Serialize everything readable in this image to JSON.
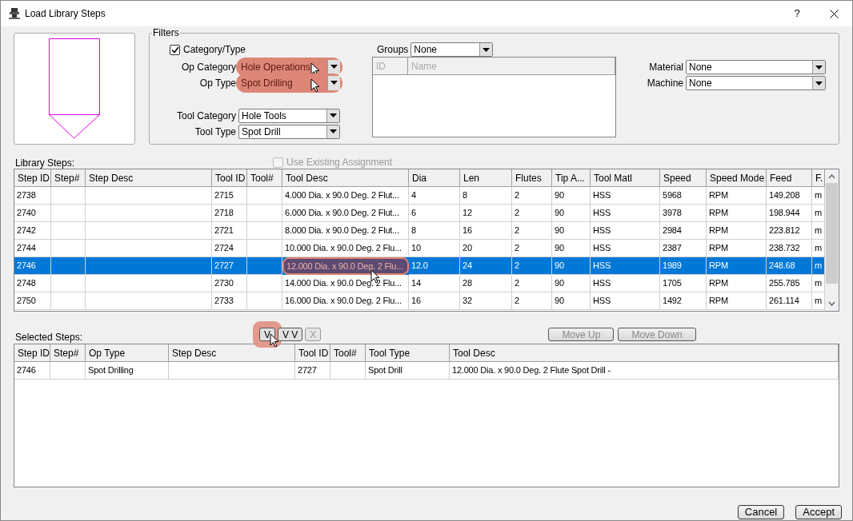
{
  "window": {
    "title": "Load Library Steps",
    "help": "?"
  },
  "filters": {
    "title": "Filters",
    "category_type": {
      "label": "Category/Type",
      "checked": true
    },
    "left_fields": [
      {
        "label": "Op Category",
        "value": "Hole Operations",
        "highlighted": true
      },
      {
        "label": "Op Type",
        "value": "Spot Drilling",
        "highlighted": true
      },
      {
        "label": "Tool Category",
        "value": "Hole Tools",
        "highlighted": false
      },
      {
        "label": "Tool Type",
        "value": "Spot Drill",
        "highlighted": false
      }
    ],
    "groups": {
      "label": "Groups",
      "value": "None",
      "columns": [
        "ID",
        "Name"
      ]
    },
    "right_fields": [
      {
        "label": "Material",
        "value": "None"
      },
      {
        "label": "Machine",
        "value": "None"
      }
    ]
  },
  "library_steps": {
    "label": "Library Steps:",
    "use_existing": {
      "label": "Use Existing Assignment",
      "checked": false,
      "disabled": true
    },
    "columns": [
      "Step ID",
      "Step#",
      "Step Desc",
      "Tool ID",
      "Tool#",
      "Tool Desc",
      "Dia",
      "Len",
      "Flutes",
      "Tip A...",
      "Tool Matl",
      "Speed",
      "Speed Mode",
      "Feed",
      "F."
    ],
    "rows": [
      {
        "selected": false,
        "cells": [
          "2738",
          "",
          "",
          "2715",
          "",
          "4.000 Dia. x 90.0 Deg. 2 Flut...",
          "4",
          "8",
          "2",
          "90",
          "HSS",
          "5968",
          "RPM",
          "149.208",
          "m"
        ]
      },
      {
        "selected": false,
        "cells": [
          "2740",
          "",
          "",
          "2718",
          "",
          "6.000 Dia. x 90.0 Deg. 2 Flut...",
          "6",
          "12",
          "2",
          "90",
          "HSS",
          "3978",
          "RPM",
          "198.944",
          "m"
        ]
      },
      {
        "selected": false,
        "cells": [
          "2742",
          "",
          "",
          "2721",
          "",
          "8.000 Dia. x 90.0 Deg. 2 Flut...",
          "8",
          "16",
          "2",
          "90",
          "HSS",
          "2984",
          "RPM",
          "223.812",
          "m"
        ]
      },
      {
        "selected": false,
        "cells": [
          "2744",
          "",
          "",
          "2724",
          "",
          "10.000 Dia. x 90.0 Deg. 2 Flu...",
          "10",
          "20",
          "2",
          "90",
          "HSS",
          "2387",
          "RPM",
          "238.732",
          "m"
        ]
      },
      {
        "selected": true,
        "cells": [
          "2746",
          "",
          "",
          "2727",
          "",
          {
            "text": "12.000 Dia. x 90.0 Deg. 2 Flu...",
            "highlighted": true
          },
          "12.0",
          "24",
          "2",
          "90",
          "HSS",
          "1989",
          "RPM",
          "248.68",
          "m"
        ]
      },
      {
        "selected": false,
        "cells": [
          "2748",
          "",
          "",
          "2730",
          "",
          "14.000 Dia. x 90.0 Deg. 2 Flu...",
          "14",
          "28",
          "2",
          "90",
          "HSS",
          "1705",
          "RPM",
          "255.785",
          "m"
        ]
      },
      {
        "selected": false,
        "cells": [
          "2750",
          "",
          "",
          "2733",
          "",
          "16.000 Dia. x 90.0 Deg. 2 Flu...",
          "16",
          "32",
          "2",
          "90",
          "HSS",
          "1492",
          "RPM",
          "261.114",
          "m"
        ]
      }
    ]
  },
  "selected_steps": {
    "label": "Selected Steps:",
    "add_buttons": [
      {
        "label": "V",
        "disabled": false,
        "highlighted": true
      },
      {
        "label": "V V",
        "disabled": false,
        "highlighted": false
      },
      {
        "label": "X",
        "disabled": true,
        "highlighted": false
      }
    ],
    "move_buttons": [
      {
        "label": "Move Up",
        "disabled": true
      },
      {
        "label": "Move Down",
        "disabled": true
      }
    ],
    "columns": [
      "Step ID",
      "Step#",
      "Op Type",
      "Step Desc",
      "Tool ID",
      "Tool#",
      "Tool Type",
      "Tool Desc"
    ],
    "rows": [
      {
        "selected": false,
        "cells": [
          "2746",
          "",
          "Spot Drilling",
          "",
          "2727",
          "",
          "Spot Drill",
          "12.000 Dia. x 90.0 Deg. 2 Flute Spot Drill -"
        ]
      }
    ]
  },
  "buttons": [
    "Cancel",
    "Accept"
  ]
}
